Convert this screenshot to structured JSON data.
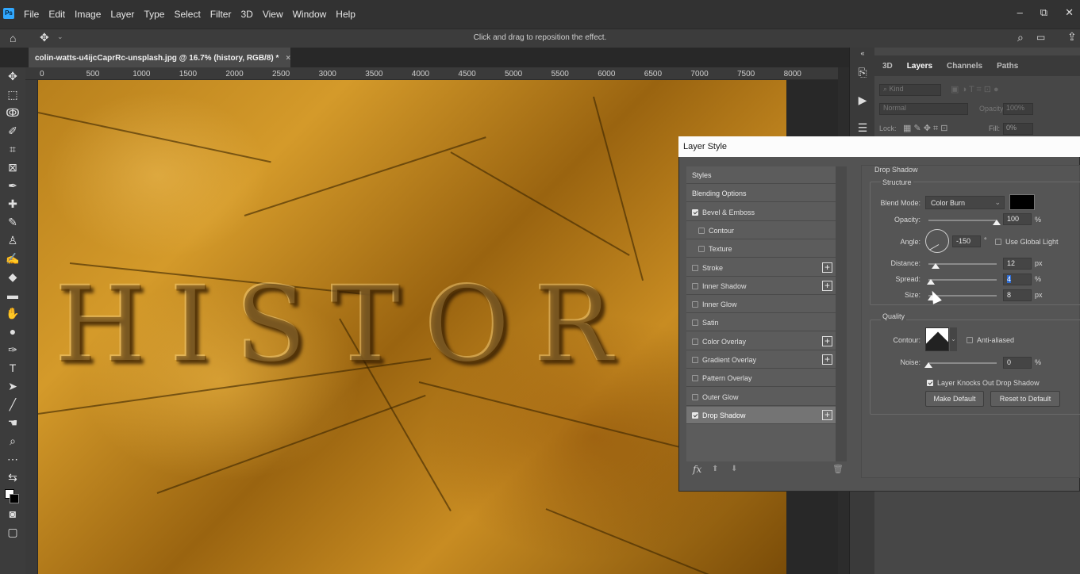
{
  "menubar": {
    "items": [
      "File",
      "Edit",
      "Image",
      "Layer",
      "Type",
      "Select",
      "Filter",
      "3D",
      "View",
      "Window",
      "Help"
    ]
  },
  "options_bar": {
    "hint": "Click and drag to reposition the effect."
  },
  "document": {
    "tab_title": "colin-watts-u4ijcCaprRc-unsplash.jpg @ 16.7% (history, RGB/8) *",
    "close": "×"
  },
  "ruler": {
    "marks": [
      "0",
      "500",
      "1000",
      "1500",
      "2000",
      "2500",
      "3000",
      "3500",
      "4000",
      "4500",
      "5000",
      "5500",
      "6000",
      "6500",
      "7000",
      "7500",
      "8000"
    ]
  },
  "canvas": {
    "text": "HISTOR"
  },
  "layers_panel": {
    "tabs": [
      "3D",
      "Layers",
      "Channels",
      "Paths"
    ],
    "active_tab": "Layers",
    "kind_placeholder": "Kind",
    "blend_mode": "Normal",
    "opacity_label": "Opacity:",
    "opacity_value": "100%",
    "lock_label": "Lock:",
    "fill_label": "Fill:",
    "fill_value": "0%"
  },
  "dialog": {
    "title": "Layer Style",
    "styles": [
      {
        "label": "Styles"
      },
      {
        "label": "Blending Options"
      },
      {
        "label": "Bevel & Emboss",
        "checked": true
      },
      {
        "label": "Contour",
        "checked": false,
        "indent": true
      },
      {
        "label": "Texture",
        "checked": false,
        "indent": true
      },
      {
        "label": "Stroke",
        "checked": false,
        "plus": true
      },
      {
        "label": "Inner Shadow",
        "checked": false,
        "plus": true
      },
      {
        "label": "Inner Glow",
        "checked": false
      },
      {
        "label": "Satin",
        "checked": false
      },
      {
        "label": "Color Overlay",
        "checked": false,
        "plus": true
      },
      {
        "label": "Gradient Overlay",
        "checked": false,
        "plus": true
      },
      {
        "label": "Pattern Overlay",
        "checked": false
      },
      {
        "label": "Outer Glow",
        "checked": false
      },
      {
        "label": "Drop Shadow",
        "checked": true,
        "plus": true,
        "selected": true
      }
    ],
    "footer_fx": "fx",
    "section_title": "Drop Shadow",
    "structure": {
      "title": "Structure",
      "blend_mode_label": "Blend Mode:",
      "blend_mode_value": "Color Burn",
      "shadow_color": "#000000",
      "opacity_label": "Opacity:",
      "opacity_value": "100",
      "opacity_unit": "%",
      "opacity_fraction": 1.0,
      "angle_label": "Angle:",
      "angle_value": "-150",
      "angle_unit": "°",
      "use_global_light": "Use Global Light",
      "distance_label": "Distance:",
      "distance_value": "12",
      "distance_unit": "px",
      "distance_fraction": 0.1,
      "spread_label": "Spread:",
      "spread_value": "4",
      "spread_unit": "%",
      "spread_fraction": 0.04,
      "size_label": "Size:",
      "size_value": "8",
      "size_unit": "px",
      "size_fraction": 0.05
    },
    "quality": {
      "title": "Quality",
      "contour_label": "Contour:",
      "anti_aliased": "Anti-aliased",
      "noise_label": "Noise:",
      "noise_value": "0",
      "noise_unit": "%",
      "noise_fraction": 0.0,
      "knockout": "Layer Knocks Out Drop Shadow",
      "knockout_checked": true
    },
    "make_default": "Make Default",
    "reset_default": "Reset to Default"
  },
  "colors": {
    "accent": "#31a8ff",
    "selection": "#2d6bd2"
  }
}
